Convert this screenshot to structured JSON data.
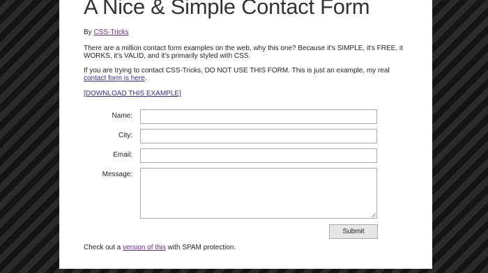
{
  "page": {
    "title": "A Nice & Simple Contact Form"
  },
  "byline": {
    "prefix": "By ",
    "author_link": "CSS-Tricks"
  },
  "intro": "There are a million contact form examples on the web, why this one? Because it's SIMPLE, it's FREE, it WORKS, it's VALID, and it's primarily styled with CSS.",
  "notice": {
    "text": "If you are trying to contact CSS-Tricks, DO NOT USE THIS FORM. This is just an example, my real ",
    "link": "contact form is here",
    "suffix": "."
  },
  "download_link": "[DOWNLOAD THIS EXAMPLE]",
  "form": {
    "fields": [
      {
        "label": "Name:",
        "value": ""
      },
      {
        "label": "City:",
        "value": ""
      },
      {
        "label": "Email:",
        "value": ""
      },
      {
        "label": "Message:",
        "value": ""
      }
    ],
    "submit_label": "Submit"
  },
  "footer": {
    "prefix": "Check out a ",
    "link": "version of this",
    "suffix": " with SPAM protection."
  },
  "colors": {
    "background_stripe_light": "#2a2a2a",
    "background_stripe_dark": "#141414",
    "page_background": "#ffffff",
    "link": "#3a2a9a"
  }
}
